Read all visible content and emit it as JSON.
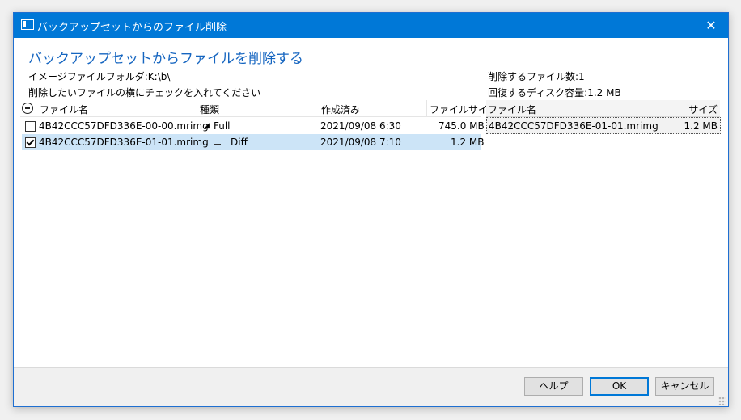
{
  "window": {
    "title": "バックアップセットからのファイル削除",
    "close_glyph": "✕"
  },
  "heading": "バックアップセットからファイルを削除する",
  "info": {
    "image_folder": "イメージファイルフォルダ:K:\\b\\",
    "instruction": "削除したいファイルの横にチェックを入れてください",
    "delete_count": "削除するファイル数:1",
    "recover_size": "回復するディスク容量:1.2 MB"
  },
  "file_table": {
    "columns": {
      "name": "ファイル名",
      "type": "種類",
      "created": "作成済み",
      "size": "ファイルサイズ"
    },
    "rows": [
      {
        "checked": false,
        "name": "4B42CCC57DFD336E-00-00.mrimg",
        "type": "Full",
        "type_glyph": "◢",
        "created": "2021/09/08 6:30",
        "size": "745.0 MB",
        "selected": false
      },
      {
        "checked": true,
        "name": "4B42CCC57DFD336E-01-01.mrimg",
        "type": "Diff",
        "type_glyph": "",
        "created": "2021/09/08 7:10",
        "size": "1.2 MB",
        "selected": true
      }
    ]
  },
  "delete_table": {
    "columns": {
      "name": "ファイル名",
      "size": "サイズ"
    },
    "rows": [
      {
        "name": "4B42CCC57DFD336E-01-01.mrimg",
        "size": "1.2 MB"
      }
    ]
  },
  "buttons": {
    "help": "ヘルプ",
    "ok": "OK",
    "cancel": "キャンセル"
  },
  "colors": {
    "titlebar": "#0078d7",
    "heading": "#1565c0",
    "selection": "#cce4f7"
  }
}
